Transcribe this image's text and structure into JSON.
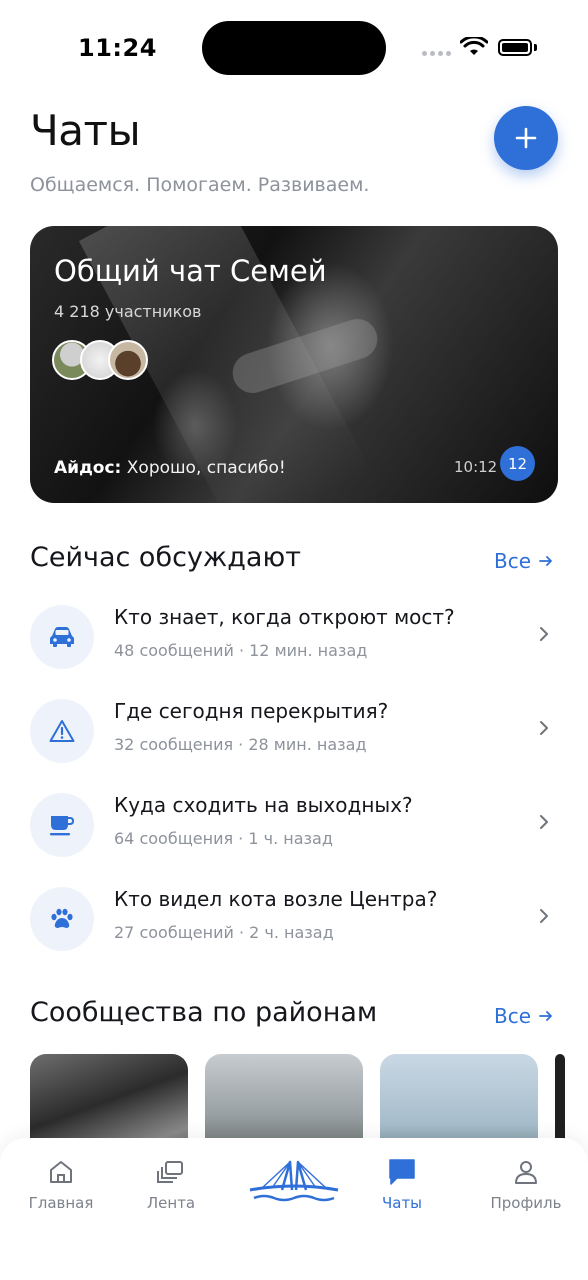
{
  "status_bar": {
    "time": "11:24"
  },
  "header": {
    "title": "Чаты",
    "subtitle": "Общаемся. Помогаем. Развиваем.",
    "add_icon": "plus-icon"
  },
  "featured_chat": {
    "title": "Общий чат Семей",
    "members": "4 218 участников",
    "last_author": "Айдос:",
    "last_message": "Хорошо, спасибо!",
    "time": "10:12",
    "unread": "12"
  },
  "discussions": {
    "title": "Сейчас обсуждают",
    "link": "Все",
    "items": [
      {
        "icon": "car-icon",
        "title": "Кто знает, когда откроют мост?",
        "meta": "48 сообщений · 12 мин. назад"
      },
      {
        "icon": "warning-icon",
        "title": "Где сегодня перекрытия?",
        "meta": "32 сообщения · 28 мин. назад"
      },
      {
        "icon": "coffee-icon",
        "title": "Куда сходить на выходных?",
        "meta": "64 сообщения · 1 ч. назад"
      },
      {
        "icon": "paw-icon",
        "title": "Кто видел кота возле Центра?",
        "meta": "27 сообщений · 2 ч. назад"
      }
    ]
  },
  "districts": {
    "title": "Сообщества по районам",
    "link": "Все"
  },
  "tab_bar": {
    "items": [
      {
        "label": "Главная",
        "icon": "home-icon"
      },
      {
        "label": "Лента",
        "icon": "feed-icon"
      },
      {
        "label": "",
        "icon": "bridge-logo"
      },
      {
        "label": "Чаты",
        "icon": "chat-icon",
        "active": true
      },
      {
        "label": "Профиль",
        "icon": "profile-icon"
      }
    ]
  },
  "colors": {
    "accent": "#2f6fd8",
    "muted": "#8d929b",
    "icon_bg": "#eef3fb"
  }
}
